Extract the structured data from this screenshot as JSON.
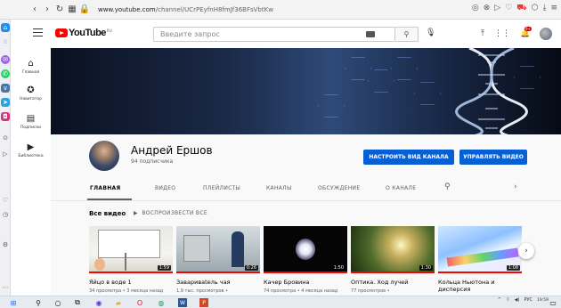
{
  "browser": {
    "url_prefix": "www.youtube.com",
    "url_path": "/channel/UCrPEyfnH8fmJf36BFsVbtKw"
  },
  "header": {
    "logo_text": "YouTube",
    "logo_region": "RU",
    "search_placeholder": "Введите запрос",
    "notification_count": "9+"
  },
  "guide": {
    "items": [
      {
        "label": "Главная",
        "icon": "home-icon"
      },
      {
        "label": "Навигатор",
        "icon": "compass-icon"
      },
      {
        "label": "Подписки",
        "icon": "subscriptions-icon"
      },
      {
        "label": "Библиотека",
        "icon": "library-icon"
      }
    ]
  },
  "channel": {
    "name": "Андрей Ершов",
    "subscribers": "94 подписчика",
    "customize_button": "НАСТРОИТЬ ВИД КАНАЛА",
    "manage_button": "УПРАВЛЯТЬ ВИДЕО"
  },
  "tabs": [
    "ГЛАВНАЯ",
    "ВИДЕО",
    "ПЛЕЙЛИСТЫ",
    "КАНАЛЫ",
    "ОБСУЖДЕНИЕ",
    "О КАНАЛЕ"
  ],
  "section": {
    "title": "Все видео",
    "play_all": "ВОСПРОИЗВЕСТИ ВСЕ"
  },
  "videos": [
    {
      "title": "Яйцо в воде 1",
      "meta": "34 просмотра • 3 месяца назад",
      "duration": "1:59"
    },
    {
      "title": "Заваривatель чая",
      "meta": "1,9 тыс. просмотров •",
      "duration": "0:26"
    },
    {
      "title": "Качер Бровина",
      "meta": "74 просмотра • 4 месяца назад",
      "duration": "1:50"
    },
    {
      "title": "Оптика. Ход лучей",
      "meta": "77 просмотров •",
      "duration": "1:30"
    },
    {
      "title": "Кольца Ньютона и дисперсия",
      "meta": "",
      "duration": "1:08"
    }
  ],
  "taskbar": {
    "lang": "РУС",
    "time": "19:59"
  },
  "colors": {
    "accent_blue": "#065fd4",
    "youtube_red": "#ff0000"
  }
}
